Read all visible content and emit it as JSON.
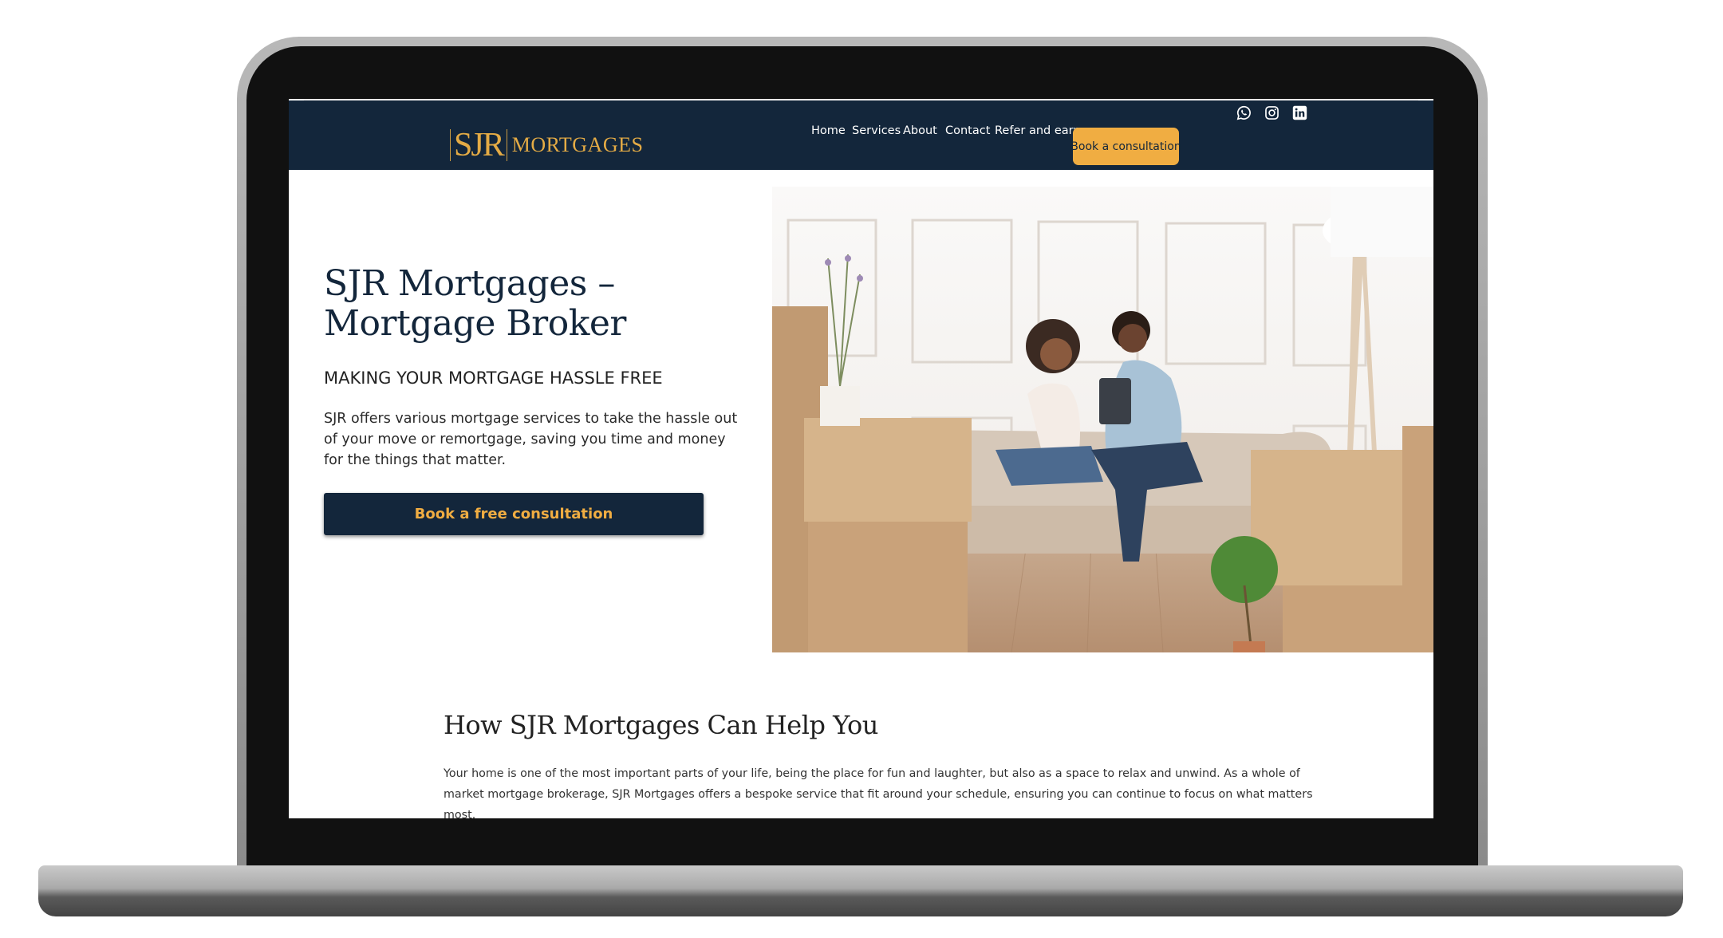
{
  "brand": {
    "monogram": "SJR",
    "wordmark": "MORTGAGES",
    "colors": {
      "navy": "#13263b",
      "gold": "#f0ad42",
      "logo_gold": "#e4ab45"
    }
  },
  "header": {
    "social_icons": [
      "whatsapp-icon",
      "instagram-icon",
      "linkedin-icon"
    ],
    "nav": [
      {
        "label": "Home"
      },
      {
        "label": "Services"
      },
      {
        "label": "About"
      },
      {
        "label": "Contact"
      },
      {
        "label": "Refer and earn"
      }
    ],
    "cta_label": "Book a consultation"
  },
  "hero": {
    "title_line1": "SJR Mortgages –",
    "title_line2": "Mortgage Broker",
    "subtitle": "MAKING YOUR MORTGAGE HASSLE FREE",
    "body": "SJR offers various mortgage services to take the hassle out of your move or remortgage, saving you time and money for the things that matter.",
    "button_label": "Book a free consultation",
    "image_alt": "Couple sitting on a sofa with a tablet surrounded by moving boxes"
  },
  "help_section": {
    "heading": "How SJR Mortgages Can Help You",
    "paragraph": "Your home is one of the most important parts of your life, being the place for fun and laughter, but also as a space to relax and unwind. As a whole of market mortgage brokerage, SJR Mortgages offers a bespoke service that fit around your schedule, ensuring you can continue to focus on what matters most."
  }
}
